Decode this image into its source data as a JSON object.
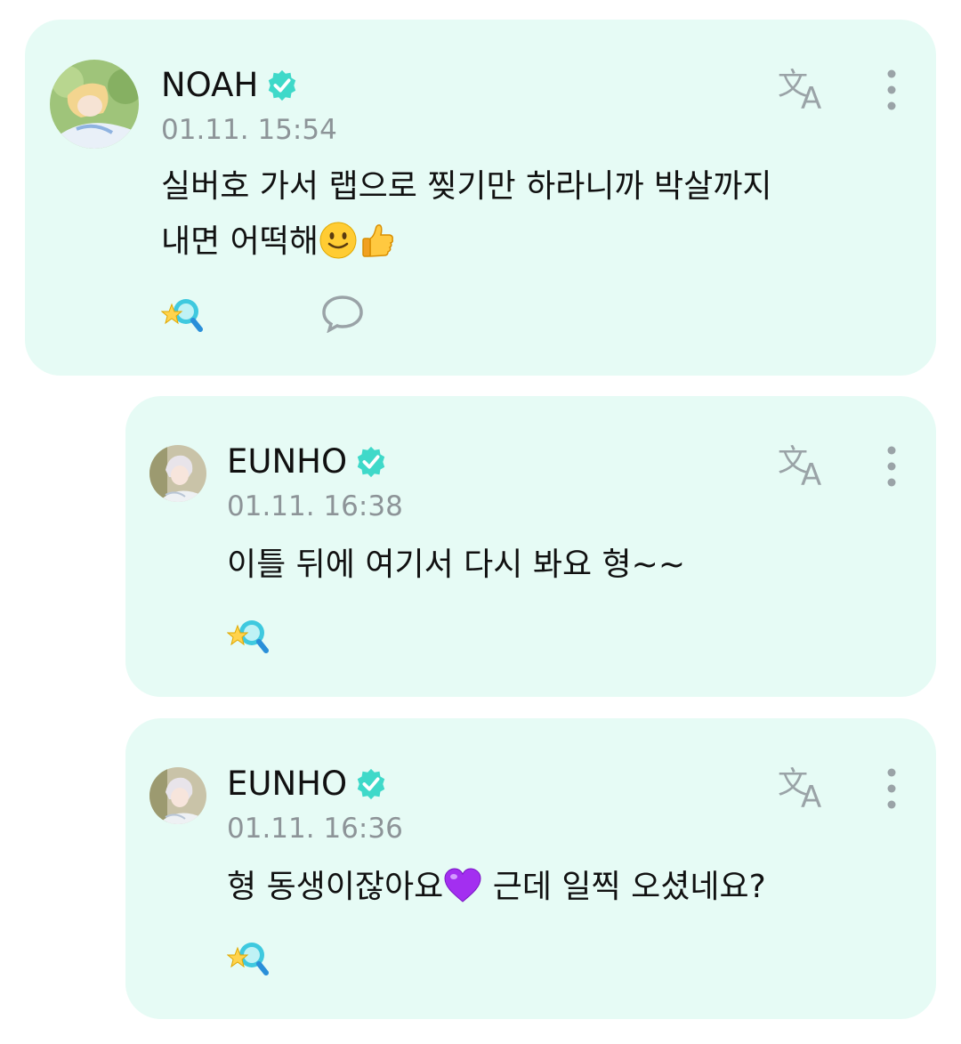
{
  "colors": {
    "card_bg": "#e6fbf5",
    "verified": "#3fd9c9",
    "icon": "#9aa3a7",
    "timestamp": "#8d9498"
  },
  "posts": [
    {
      "author": "NOAH",
      "verified": true,
      "timestamp": "01.11. 15:54",
      "text_line1": "실버호 가서 랩으로 찢기만 하라니까 박살까지",
      "text_line2": "내면 어떡해",
      "emojis": [
        "smiling-face",
        "thumbs-up"
      ],
      "has_comment_button": true,
      "comment_count": ""
    },
    {
      "author": "EUNHO",
      "verified": true,
      "timestamp": "01.11. 16:38",
      "text": "이틀 뒤에 여기서 다시 봐요 형~~"
    },
    {
      "author": "EUNHO",
      "verified": true,
      "timestamp": "01.11. 16:36",
      "text_before": "형 동생이잖아요",
      "text_after": " 근데 일찍 오셨네요?",
      "emojis": [
        "purple-heart"
      ]
    }
  ],
  "icons": {
    "translate": "translate-icon",
    "more": "more-vertical-icon",
    "reaction": "star-reaction-icon",
    "comment": "comment-bubble-icon",
    "verified": "verified-badge-icon"
  }
}
